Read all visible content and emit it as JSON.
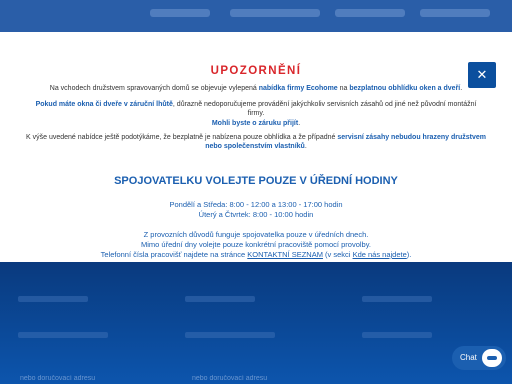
{
  "notice": {
    "title": "UPOZORNĚNÍ",
    "para1_pre": "Na vchodech družstvem spravovaných domů se objevuje vylepená ",
    "para1_hl1": "nabídka firmy Ecohome",
    "para1_mid": " na ",
    "para1_hl2": "bezplatnou obhlídku oken a dveří",
    "para1_end": ".",
    "para2_hl": "Pokud máte okna či dveře v záruční lhůtě",
    "para2_text": ", důrazně nedoporučujeme provádění jakýchkoliv servisních zásahů od jiné než původní montážní firmy.",
    "para2_hl2": "Mohli byste o záruku přijít",
    "para2_end": ".",
    "para3_pre": "K výše uvedené nabídce ještě podotýkáme, že bezplatně je nabízena pouze obhlídka a že případné ",
    "para3_hl": "servisní zásahy nebudou hrazeny družstvem nebo společenstvím vlastníků",
    "para3_end": ".",
    "hours_title": "SPOJOVATELKU VOLEJTE POUZE V ÚŘEDNÍ HODINY",
    "hours_line1": "Pondělí a Středa: 8:00 - 12:00 a 13:00 - 17:00 hodin",
    "hours_line2": "Úterý a Čtvrtek: 8:00 - 10:00 hodin",
    "info_line1": "Z provozních důvodů funguje spojovatelka pouze v úředních dnech.",
    "info_line2": "Mimo úřední dny volejte pouze konkrétní pracoviště pomocí provolby.",
    "info_line3_pre": "Telefonní čísla pracovišť najdete na stránce ",
    "info_link1": "KONTAKTNÍ SEZNAM",
    "info_line3_mid": " (v sekci ",
    "info_link2": "Kde nás najdete",
    "info_line3_end": ")."
  },
  "close_icon": "close-icon",
  "chat": {
    "label": "Chat",
    "icon": "chat-bubble-icon"
  },
  "footer": {
    "text1": "nebo doručovací adresu",
    "text2": "nebo doručovací adresu"
  },
  "colors": {
    "accent": "#1b5fb0",
    "title_red": "#d9262b",
    "backdrop": "#0b3f86"
  }
}
